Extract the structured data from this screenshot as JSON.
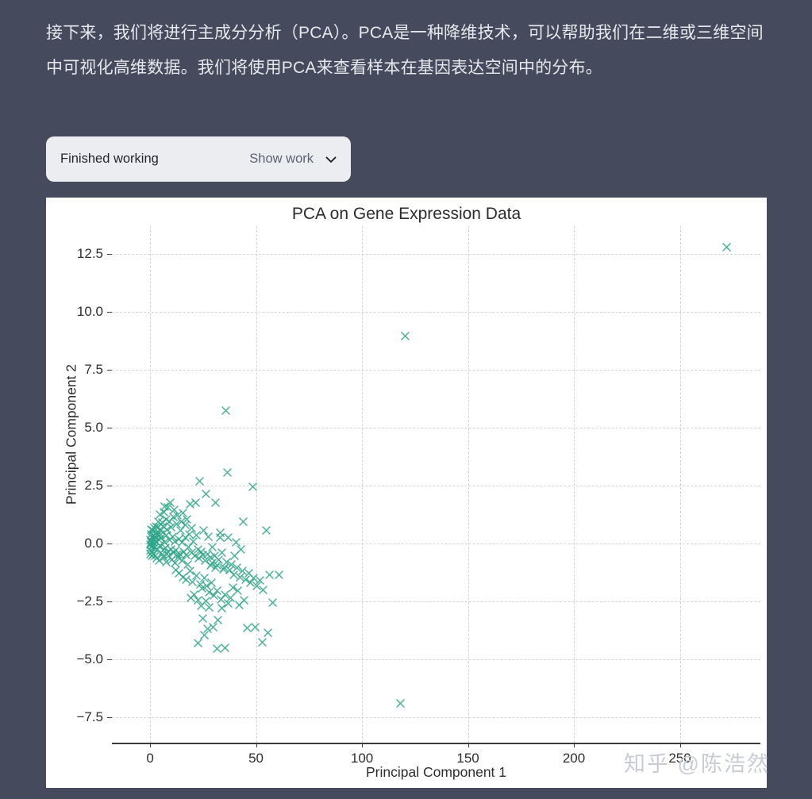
{
  "page": {
    "background_color": "#454b5c",
    "intro_text": "接下来，我们将进行主成分分析（PCA）。PCA是一种降维技术，可以帮助我们在二维或三维空间中可视化高维数据。我们将使用PCA来查看样本在基因表达空间中的分布。"
  },
  "work_panel": {
    "status_label": "Finished working",
    "show_work_label": "Show work",
    "chevron_icon": "chevron-down-icon",
    "background_color": "#ecedf1"
  },
  "watermark": {
    "text": "知乎 @陈浩然"
  },
  "chart_data": {
    "type": "scatter",
    "title": "PCA on Gene Expression Data",
    "xlabel": "Principal Component 1",
    "ylabel": "Principal Component 2",
    "marker": "x",
    "marker_color": "#2ba587",
    "grid": true,
    "legend": null,
    "xlim": [
      -18,
      288
    ],
    "ylim": [
      -8.6,
      13.7
    ],
    "xticks": [
      0,
      50,
      100,
      150,
      200,
      250
    ],
    "xticklabels": [
      "0",
      "50",
      "100",
      "150",
      "200",
      "250"
    ],
    "yticks": [
      -7.5,
      -5.0,
      -2.5,
      0.0,
      2.5,
      5.0,
      7.5,
      10.0,
      12.5
    ],
    "yticklabels": [
      "−7.5",
      "−5.0",
      "−2.5",
      "0.0",
      "2.5",
      "5.0",
      "7.5",
      "10.0",
      "12.5"
    ],
    "points": [
      [
        272.0,
        12.78
      ],
      [
        120.5,
        8.95
      ],
      [
        118.0,
        -6.9
      ],
      [
        35.8,
        5.75
      ],
      [
        36.5,
        3.05
      ],
      [
        23.5,
        2.7
      ],
      [
        48.5,
        2.45
      ],
      [
        31.0,
        1.75
      ],
      [
        26.5,
        2.15
      ],
      [
        21.5,
        1.75
      ],
      [
        19.0,
        1.7
      ],
      [
        15.5,
        1.3
      ],
      [
        13.0,
        1.2
      ],
      [
        17.5,
        1.05
      ],
      [
        11.0,
        1.15
      ],
      [
        9.0,
        0.95
      ],
      [
        7.5,
        1.05
      ],
      [
        12.5,
        0.85
      ],
      [
        10.0,
        0.7
      ],
      [
        8.0,
        0.6
      ],
      [
        6.0,
        0.75
      ],
      [
        5.0,
        0.55
      ],
      [
        4.0,
        0.7
      ],
      [
        14.5,
        0.55
      ],
      [
        18.5,
        0.4
      ],
      [
        22.0,
        0.35
      ],
      [
        27.5,
        0.3
      ],
      [
        33.0,
        0.25
      ],
      [
        40.5,
        0.05
      ],
      [
        44.0,
        0.95
      ],
      [
        55.0,
        0.55
      ],
      [
        3.0,
        0.45
      ],
      [
        2.5,
        0.3
      ],
      [
        2.0,
        0.2
      ],
      [
        1.5,
        0.35
      ],
      [
        1.0,
        0.25
      ],
      [
        0.8,
        0.1
      ],
      [
        0.5,
        0.05
      ],
      [
        0.3,
        -0.05
      ],
      [
        0.2,
        0.15
      ],
      [
        0.6,
        -0.15
      ],
      [
        1.2,
        -0.1
      ],
      [
        1.8,
        0.05
      ],
      [
        2.2,
        -0.2
      ],
      [
        2.8,
        0.1
      ],
      [
        3.4,
        -0.25
      ],
      [
        4.2,
        0.15
      ],
      [
        4.8,
        -0.1
      ],
      [
        5.4,
        0.25
      ],
      [
        6.2,
        -0.3
      ],
      [
        6.8,
        0.05
      ],
      [
        7.2,
        -0.2
      ],
      [
        7.8,
        0.35
      ],
      [
        8.4,
        -0.35
      ],
      [
        9.2,
        0.15
      ],
      [
        9.8,
        -0.25
      ],
      [
        10.5,
        0.3
      ],
      [
        11.2,
        -0.4
      ],
      [
        11.8,
        0.1
      ],
      [
        12.2,
        -0.3
      ],
      [
        13.5,
        0.2
      ],
      [
        14.0,
        -0.45
      ],
      [
        15.0,
        0.05
      ],
      [
        16.0,
        -0.35
      ],
      [
        16.8,
        0.25
      ],
      [
        17.2,
        -0.5
      ],
      [
        18.0,
        -0.15
      ],
      [
        19.5,
        -0.4
      ],
      [
        20.5,
        0.1
      ],
      [
        21.0,
        -0.55
      ],
      [
        22.5,
        -0.25
      ],
      [
        23.0,
        -0.65
      ],
      [
        24.0,
        -0.35
      ],
      [
        25.0,
        -0.5
      ],
      [
        26.0,
        -0.75
      ],
      [
        27.0,
        -0.45
      ],
      [
        28.5,
        -0.6
      ],
      [
        29.5,
        -0.85
      ],
      [
        30.5,
        -0.55
      ],
      [
        31.5,
        -0.95
      ],
      [
        32.5,
        -0.7
      ],
      [
        34.0,
        -0.4
      ],
      [
        35.0,
        -1.05
      ],
      [
        36.0,
        -0.8
      ],
      [
        37.5,
        -1.15
      ],
      [
        38.5,
        -0.9
      ],
      [
        39.5,
        -1.35
      ],
      [
        41.0,
        -1.05
      ],
      [
        42.5,
        -1.45
      ],
      [
        43.5,
        -1.2
      ],
      [
        45.0,
        -1.55
      ],
      [
        46.5,
        -1.3
      ],
      [
        47.5,
        -1.7
      ],
      [
        49.0,
        -1.5
      ],
      [
        50.5,
        -1.85
      ],
      [
        52.0,
        -1.6
      ],
      [
        53.5,
        -2.0
      ],
      [
        56.5,
        -1.35
      ],
      [
        58.0,
        -2.55
      ],
      [
        61.0,
        -1.35
      ],
      [
        12.0,
        -1.15
      ],
      [
        13.8,
        -1.3
      ],
      [
        15.5,
        -1.45
      ],
      [
        17.0,
        -1.55
      ],
      [
        18.8,
        -1.2
      ],
      [
        20.0,
        -1.65
      ],
      [
        21.8,
        -1.4
      ],
      [
        23.8,
        -1.75
      ],
      [
        25.5,
        -1.5
      ],
      [
        24.5,
        -1.95
      ],
      [
        26.8,
        -1.85
      ],
      [
        28.0,
        -2.1
      ],
      [
        29.0,
        -1.7
      ],
      [
        30.0,
        -2.25
      ],
      [
        31.8,
        -2.05
      ],
      [
        33.5,
        -2.4
      ],
      [
        35.5,
        -2.2
      ],
      [
        37.0,
        -2.6
      ],
      [
        38.0,
        -2.35
      ],
      [
        22.8,
        -2.45
      ],
      [
        24.2,
        -2.7
      ],
      [
        26.2,
        -2.5
      ],
      [
        27.8,
        -2.75
      ],
      [
        20.8,
        -2.2
      ],
      [
        19.2,
        -2.35
      ],
      [
        33.8,
        -2.8
      ],
      [
        39.0,
        -1.9
      ],
      [
        41.5,
        -2.05
      ],
      [
        24.8,
        -3.25
      ],
      [
        29.8,
        -3.6
      ],
      [
        32.0,
        -3.3
      ],
      [
        27.2,
        -3.7
      ],
      [
        22.5,
        -4.3
      ],
      [
        25.5,
        -3.95
      ],
      [
        35.5,
        -4.5
      ],
      [
        31.5,
        -4.55
      ],
      [
        46.0,
        -3.65
      ],
      [
        49.5,
        -3.6
      ],
      [
        53.0,
        -4.25
      ],
      [
        55.5,
        -3.85
      ],
      [
        44.5,
        -2.45
      ],
      [
        42.0,
        -2.65
      ],
      [
        30.8,
        -1.05
      ],
      [
        28.8,
        -0.95
      ],
      [
        34.5,
        -1.1
      ],
      [
        40.0,
        -0.55
      ],
      [
        43.0,
        -0.25
      ],
      [
        8.5,
        1.55
      ],
      [
        11.5,
        1.45
      ],
      [
        6.5,
        1.35
      ],
      [
        14.8,
        0.95
      ],
      [
        16.5,
        0.8
      ],
      [
        4.5,
        1.25
      ],
      [
        5.8,
        0.9
      ],
      [
        3.8,
        0.95
      ],
      [
        9.5,
        1.75
      ],
      [
        7.0,
        1.6
      ],
      [
        2.6,
        0.75
      ],
      [
        19.8,
        0.65
      ],
      [
        25.2,
        0.55
      ],
      [
        29.2,
        -0.15
      ],
      [
        36.8,
        0.25
      ],
      [
        33.2,
        0.45
      ],
      [
        0.4,
        0.4
      ],
      [
        0.9,
        -0.35
      ],
      [
        1.6,
        -0.45
      ],
      [
        2.4,
        -0.55
      ],
      [
        3.2,
        -0.65
      ],
      [
        4.4,
        -0.75
      ],
      [
        5.6,
        -0.45
      ],
      [
        6.4,
        -0.6
      ],
      [
        7.6,
        -0.8
      ],
      [
        8.8,
        -0.55
      ],
      [
        10.2,
        -0.7
      ],
      [
        11.6,
        -0.85
      ],
      [
        13.2,
        -0.6
      ],
      [
        15.2,
        -0.75
      ],
      [
        17.8,
        -0.9
      ],
      [
        12.8,
        -0.45
      ],
      [
        0.1,
        -0.3
      ],
      [
        0.7,
        0.6
      ],
      [
        1.4,
        0.55
      ],
      [
        2.1,
        0.65
      ],
      [
        3.6,
        0.35
      ],
      [
        5.2,
        0.4
      ],
      [
        0.35,
        -0.45
      ],
      [
        1.1,
        -0.55
      ]
    ]
  }
}
